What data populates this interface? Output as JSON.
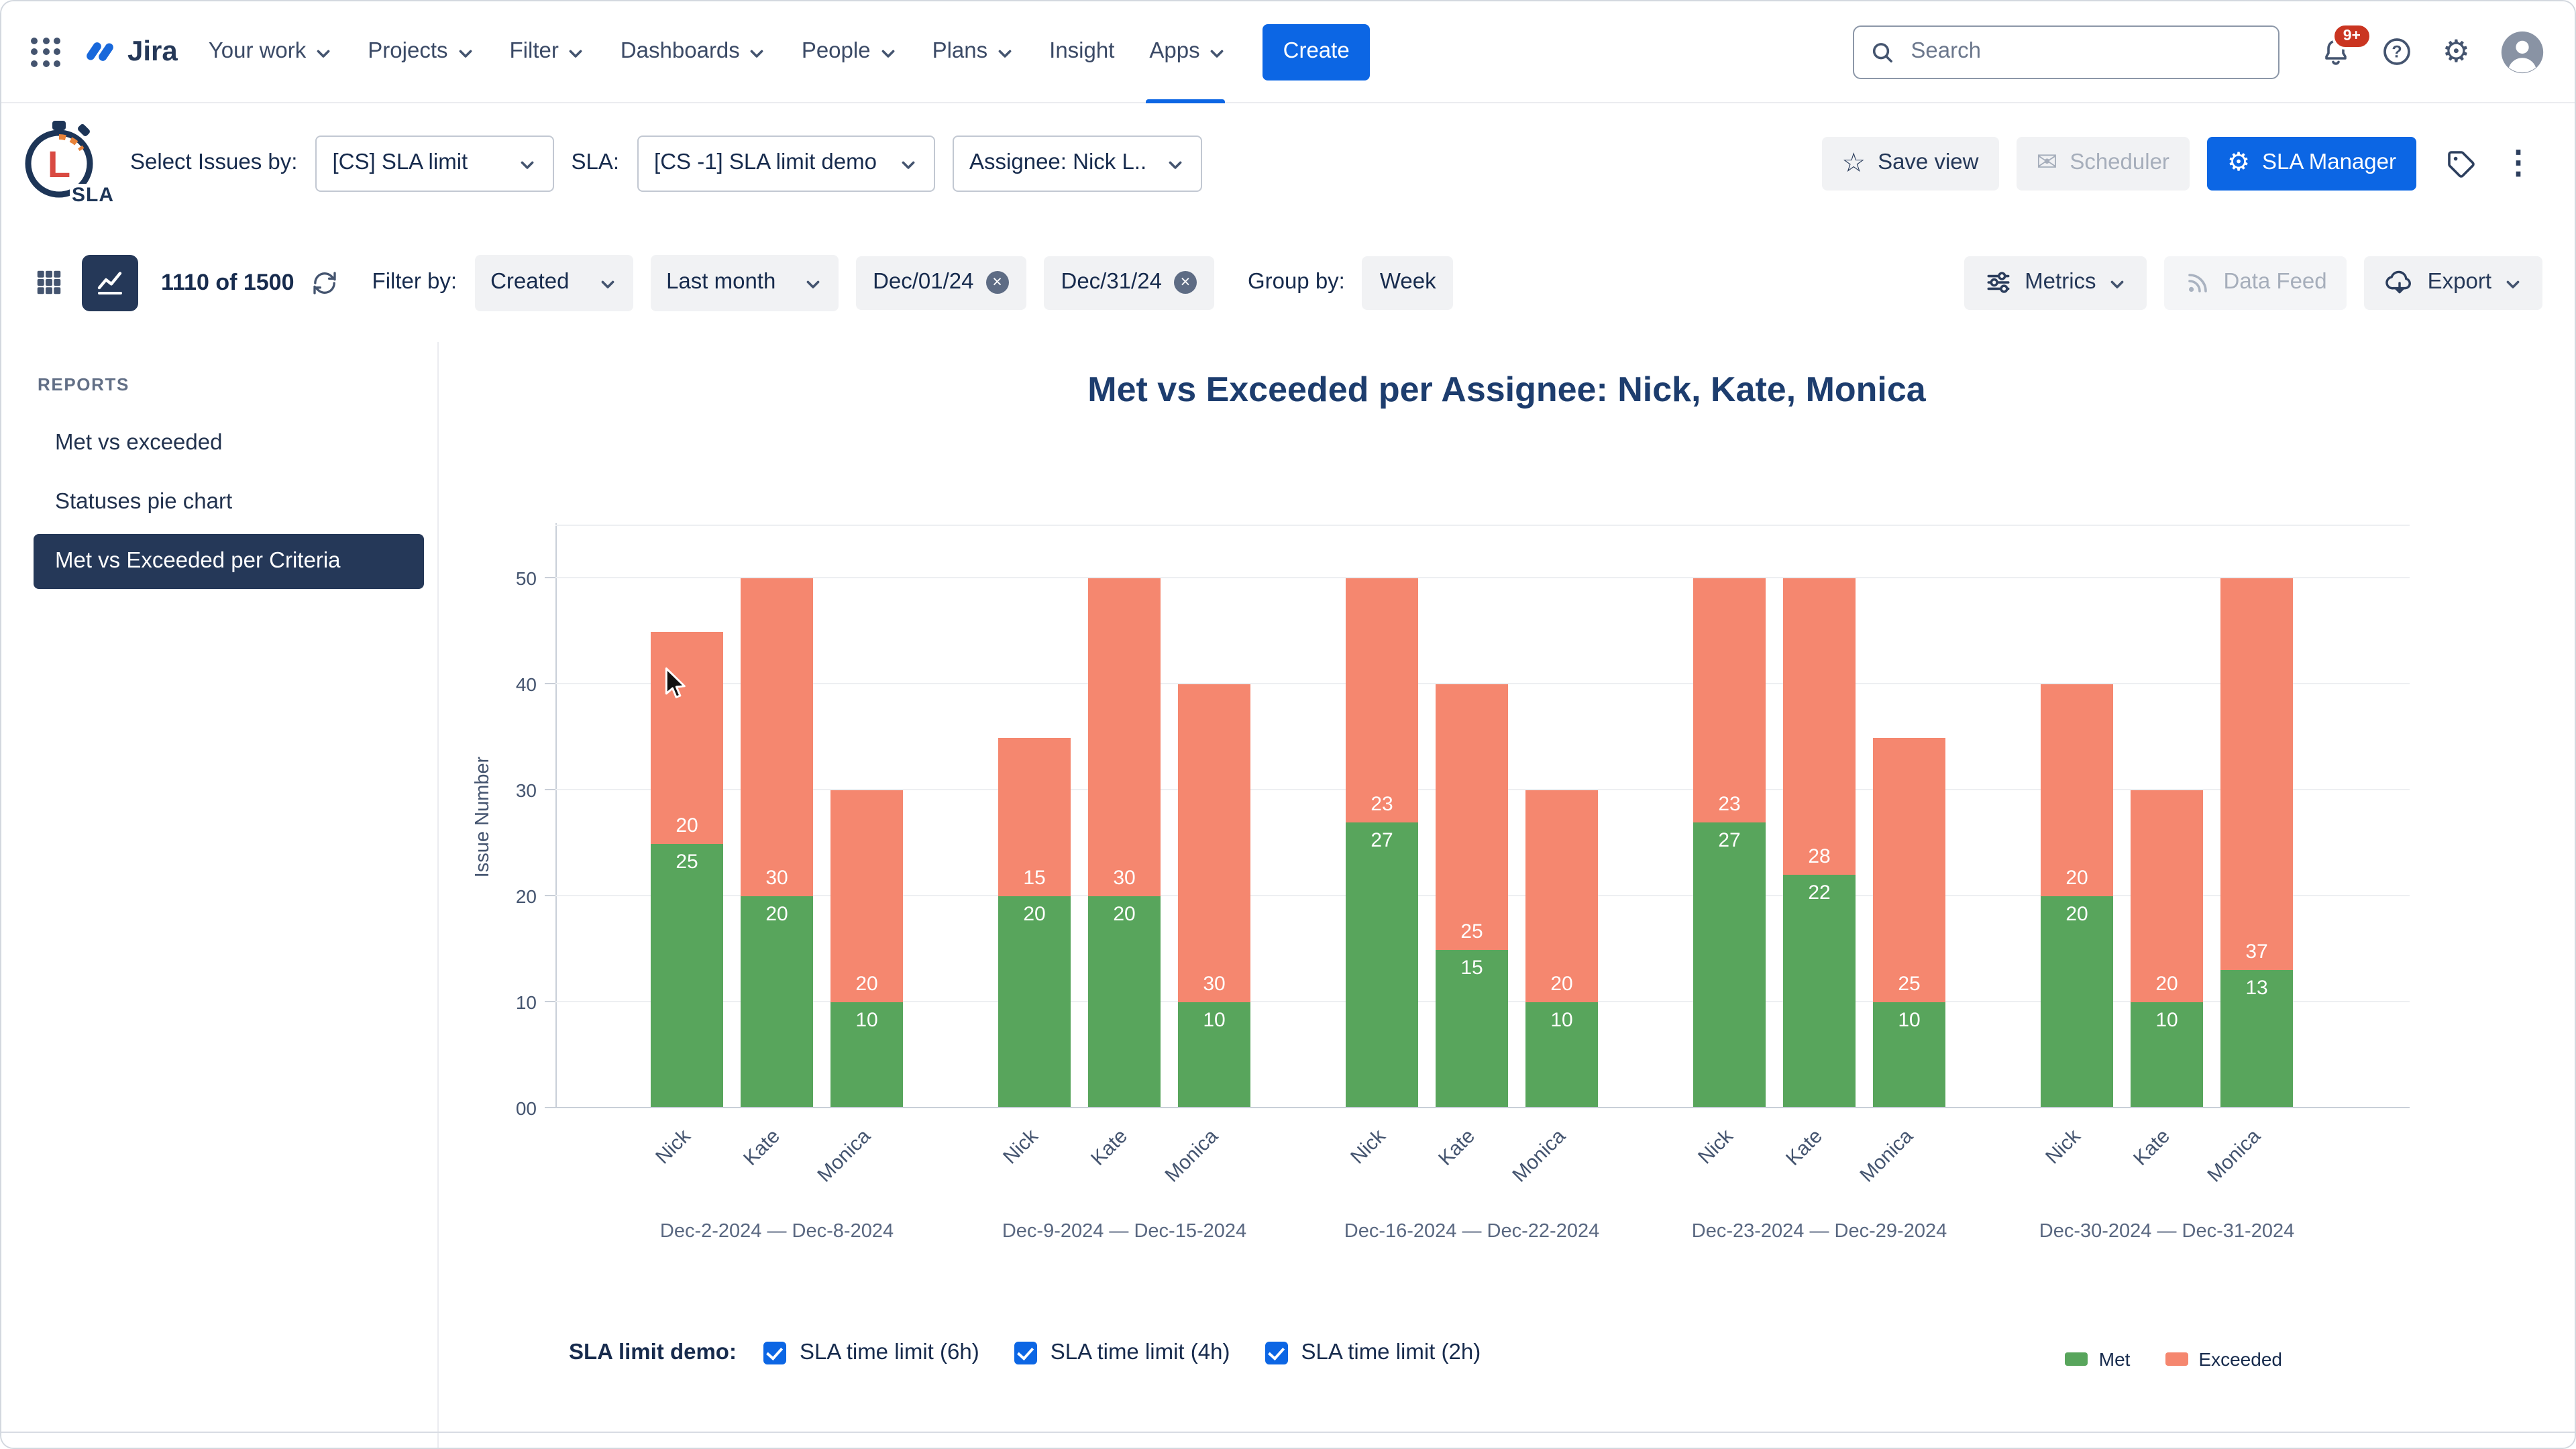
{
  "nav": {
    "logo_text": "Jira",
    "items": [
      {
        "label": "Your work",
        "chevron": true,
        "active": false
      },
      {
        "label": "Projects",
        "chevron": true,
        "active": false
      },
      {
        "label": "Filter",
        "chevron": true,
        "active": false
      },
      {
        "label": "Dashboards",
        "chevron": true,
        "active": false
      },
      {
        "label": "People",
        "chevron": true,
        "active": false
      },
      {
        "label": "Plans",
        "chevron": true,
        "active": false
      },
      {
        "label": "Insight",
        "chevron": false,
        "active": false
      },
      {
        "label": "Apps",
        "chevron": true,
        "active": true
      }
    ],
    "create_label": "Create",
    "search_placeholder": "Search",
    "notification_badge": "9+"
  },
  "toolbar": {
    "select_issues_label": "Select Issues by:",
    "issues_dropdown": "[CS] SLA limit",
    "sla_label": "SLA:",
    "sla_dropdown": "[CS -1] SLA limit demo",
    "assignee_dropdown": "Assignee: Nick L..",
    "save_view": "Save view",
    "scheduler": "Scheduler",
    "sla_manager": "SLA Manager"
  },
  "filter_bar": {
    "count": "1110 of 1500",
    "filter_by_label": "Filter by:",
    "created_dropdown": "Created",
    "period_dropdown": "Last month",
    "date_chips": [
      "Dec/01/24",
      "Dec/31/24"
    ],
    "group_by_label": "Group by:",
    "group_by_value": "Week",
    "metrics": "Metrics",
    "data_feed": "Data Feed",
    "export": "Export"
  },
  "sidebar": {
    "header": "REPORTS",
    "items": [
      {
        "label": "Met vs exceeded",
        "active": false
      },
      {
        "label": "Statuses pie chart",
        "active": false
      },
      {
        "label": "Met vs Exceeded per Criteria",
        "active": true
      }
    ]
  },
  "chart_data": {
    "type": "bar",
    "stacked": true,
    "title": "Met vs Exceeded per Assignee: Nick, Kate, Monica",
    "ylabel": "Issue Number",
    "ylim": [
      0,
      55
    ],
    "yticks": [
      "00",
      "10",
      "20",
      "30",
      "40",
      "50"
    ],
    "grid": true,
    "legend_position": "bottom-right",
    "colors": {
      "met": "#58A55C",
      "exceeded": "#F5876F"
    },
    "legend": [
      "Met",
      "Exceeded"
    ],
    "groups": [
      {
        "range": "Dec-2-2024 — Dec-8-2024",
        "bars": [
          {
            "name": "Nick",
            "met": 25,
            "exceeded": 20
          },
          {
            "name": "Kate",
            "met": 20,
            "exceeded": 30
          },
          {
            "name": "Monica",
            "met": 10,
            "exceeded": 20
          }
        ]
      },
      {
        "range": "Dec-9-2024 — Dec-15-2024",
        "bars": [
          {
            "name": "Nick",
            "met": 20,
            "exceeded": 15
          },
          {
            "name": "Kate",
            "met": 20,
            "exceeded": 30
          },
          {
            "name": "Monica",
            "met": 10,
            "exceeded": 30
          }
        ]
      },
      {
        "range": "Dec-16-2024 — Dec-22-2024",
        "bars": [
          {
            "name": "Nick",
            "met": 27,
            "exceeded": 23
          },
          {
            "name": "Kate",
            "met": 15,
            "exceeded": 25
          },
          {
            "name": "Monica",
            "met": 10,
            "exceeded": 20
          }
        ]
      },
      {
        "range": "Dec-23-2024 — Dec-29-2024",
        "bars": [
          {
            "name": "Nick",
            "met": 27,
            "exceeded": 23
          },
          {
            "name": "Kate",
            "met": 22,
            "exceeded": 28
          },
          {
            "name": "Monica",
            "met": 10,
            "exceeded": 25
          }
        ]
      },
      {
        "range": "Dec-30-2024 — Dec-31-2024",
        "bars": [
          {
            "name": "Nick",
            "met": 20,
            "exceeded": 20
          },
          {
            "name": "Kate",
            "met": 10,
            "exceeded": 20
          },
          {
            "name": "Monica",
            "met": 13,
            "exceeded": 37
          }
        ]
      }
    ]
  },
  "footer": {
    "label": "SLA limit demo:",
    "checkboxes": [
      {
        "label": "SLA time limit (6h)",
        "checked": true
      },
      {
        "label": "SLA time limit (4h)",
        "checked": true
      },
      {
        "label": "SLA time limit (2h)",
        "checked": true
      }
    ],
    "legend": [
      {
        "label": "Met",
        "color": "#58A55C"
      },
      {
        "label": "Exceeded",
        "color": "#F5876F"
      }
    ]
  },
  "sla_logo": {
    "letter": "L",
    "text": "SLA"
  },
  "icons": {
    "gear": "⚙",
    "star": "☆",
    "mail": "✉",
    "kebab": "⋮",
    "close": "×",
    "help": "?"
  },
  "colors": {
    "primary": "#0C66E4",
    "badge_red": "#CA3521",
    "selected_nav": "#253858",
    "met": "#58A55C",
    "exceeded": "#F5876F"
  }
}
